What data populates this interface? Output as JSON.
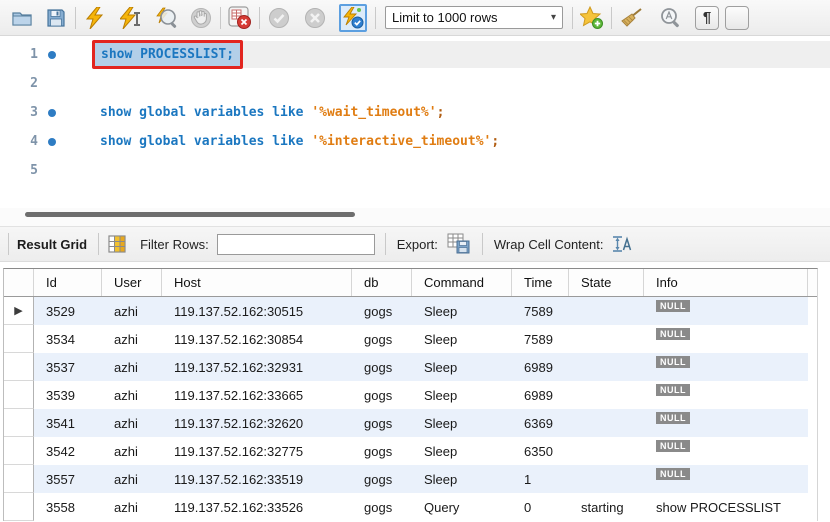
{
  "toolbar": {
    "limit_dropdown": "Limit to 1000 rows",
    "buttons": [
      "open-script",
      "save-script",
      "execute-statements",
      "execute-current-statement",
      "explain-plan",
      "stop-query",
      "toggle-stop-on-error",
      "commit",
      "rollback",
      "toggle-autocommit",
      "save-snippet",
      "beautify-script",
      "find-panel",
      "invisible-characters",
      "wrap-text"
    ]
  },
  "glyphs": {
    "caret": "▾",
    "pilcrow": "¶",
    "row_marker": "▶"
  },
  "colors": {
    "keyword_blue": "#1b77c0",
    "string_orange": "#e07d13",
    "annotation_red": "#e2251f",
    "selection_blue": "#b3cfe8",
    "statement_line_highlight": "#efefef",
    "alt_row_blue": "#eaf1fb",
    "null_badge_gray": "#8a8a8a"
  },
  "editor": {
    "lines": [
      {
        "num": "1",
        "tokens": [
          {
            "text": "show PROCESSLIST;",
            "type": "keyword"
          }
        ]
      },
      {
        "num": "2",
        "tokens": []
      },
      {
        "num": "3",
        "tokens": [
          {
            "text": "show global variables like ",
            "type": "keyword"
          },
          {
            "text": "'%wait_timeout%'",
            "type": "string"
          },
          {
            "text": ";",
            "type": "semi"
          }
        ]
      },
      {
        "num": "4",
        "tokens": [
          {
            "text": "show global variables like ",
            "type": "keyword"
          },
          {
            "text": "'%interactive_timeout%'",
            "type": "string"
          },
          {
            "text": ";",
            "type": "semi"
          }
        ]
      },
      {
        "num": "5",
        "tokens": []
      }
    ]
  },
  "result_toolbar": {
    "title": "Result Grid",
    "filter_label": "Filter Rows:",
    "filter_value": "",
    "export_label": "Export:",
    "wrap_label": "Wrap Cell Content:"
  },
  "table": {
    "columns": [
      "Id",
      "User",
      "Host",
      "db",
      "Command",
      "Time",
      "State",
      "Info"
    ],
    "null_label": "NULL",
    "rows": [
      {
        "id": "3529",
        "user": "azhi",
        "host": "119.137.52.162:30515",
        "db": "gogs",
        "command": "Sleep",
        "time": "7589",
        "state": "",
        "info": "NULL"
      },
      {
        "id": "3534",
        "user": "azhi",
        "host": "119.137.52.162:30854",
        "db": "gogs",
        "command": "Sleep",
        "time": "7589",
        "state": "",
        "info": "NULL"
      },
      {
        "id": "3537",
        "user": "azhi",
        "host": "119.137.52.162:32931",
        "db": "gogs",
        "command": "Sleep",
        "time": "6989",
        "state": "",
        "info": "NULL"
      },
      {
        "id": "3539",
        "user": "azhi",
        "host": "119.137.52.162:33665",
        "db": "gogs",
        "command": "Sleep",
        "time": "6989",
        "state": "",
        "info": "NULL"
      },
      {
        "id": "3541",
        "user": "azhi",
        "host": "119.137.52.162:32620",
        "db": "gogs",
        "command": "Sleep",
        "time": "6369",
        "state": "",
        "info": "NULL"
      },
      {
        "id": "3542",
        "user": "azhi",
        "host": "119.137.52.162:32775",
        "db": "gogs",
        "command": "Sleep",
        "time": "6350",
        "state": "",
        "info": "NULL"
      },
      {
        "id": "3557",
        "user": "azhi",
        "host": "119.137.52.162:33519",
        "db": "gogs",
        "command": "Sleep",
        "time": "1",
        "state": "",
        "info": "NULL"
      },
      {
        "id": "3558",
        "user": "azhi",
        "host": "119.137.52.162:33526",
        "db": "gogs",
        "command": "Query",
        "time": "0",
        "state": "starting",
        "info": "show PROCESSLIST"
      }
    ]
  }
}
